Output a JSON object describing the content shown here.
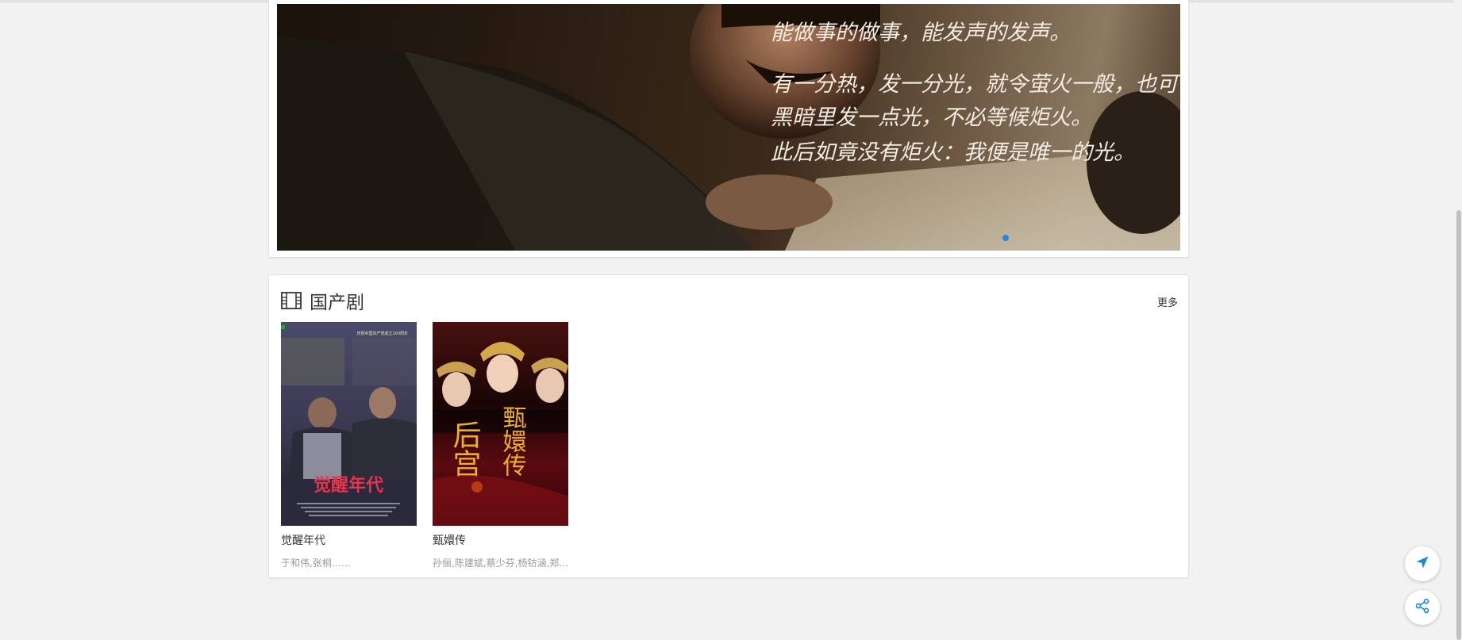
{
  "banner": {
    "calligraphy_lines": [
      "能做事的做事，能发声的发声。",
      "有一分热，发一分光，就令萤火一般，也可以在",
      "黑暗里发一点光，不必等候炬火。",
      "此后如竟没有炬火：我便是唯一的光。"
    ],
    "dot_color": "#1e88e5"
  },
  "section": {
    "title": "国产剧",
    "more_label": "更多",
    "icon": "film-icon"
  },
  "movies": [
    {
      "title": "觉醒年代",
      "cast": "于和伟,张桐……",
      "poster_text": "觉醒年代",
      "poster_badge": "庆祝中国共产党成立100周年"
    },
    {
      "title": "甄嬛传",
      "cast": "孙俪,陈建斌,蔡少芬,杨钫涵,郑...",
      "poster_text_left": "后宫",
      "poster_text_right": "甄嬛传"
    }
  ],
  "fabs": {
    "rocket_icon": "rocket-icon",
    "share_icon": "share-icon",
    "accent": "#1e88e5"
  }
}
